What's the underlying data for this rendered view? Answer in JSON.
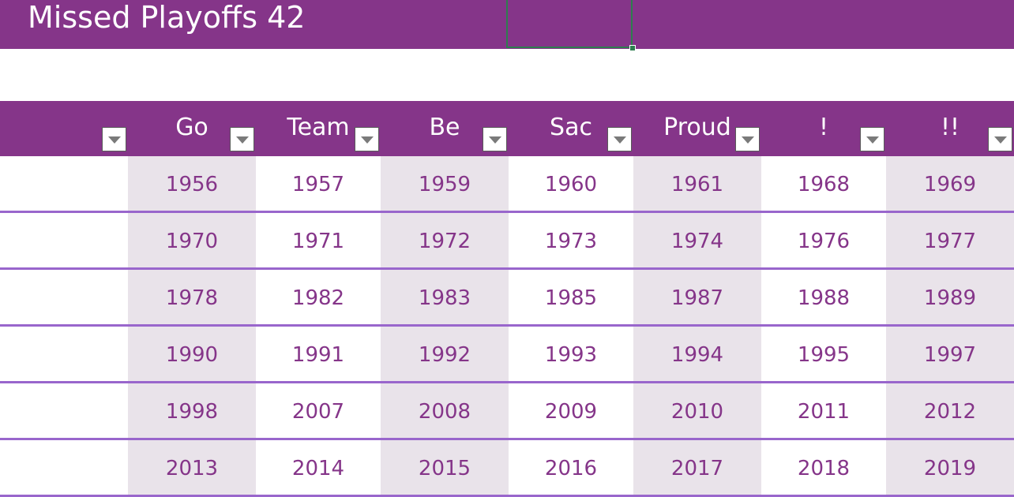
{
  "sheet": {
    "title": "Missed Playoffs 42"
  },
  "table": {
    "headers": [
      "",
      "Go",
      "Team",
      "Be",
      "Sac",
      "Proud",
      "!",
      "!!"
    ],
    "rows": [
      [
        "",
        "1956",
        "1957",
        "1959",
        "1960",
        "1961",
        "1968",
        "1969"
      ],
      [
        "",
        "1970",
        "1971",
        "1972",
        "1973",
        "1974",
        "1976",
        "1977"
      ],
      [
        "",
        "1978",
        "1982",
        "1983",
        "1985",
        "1987",
        "1988",
        "1989"
      ],
      [
        "",
        "1990",
        "1991",
        "1992",
        "1993",
        "1994",
        "1995",
        "1997"
      ],
      [
        "",
        "1998",
        "2007",
        "2008",
        "2009",
        "2010",
        "2011",
        "2012"
      ],
      [
        "",
        "2013",
        "2014",
        "2015",
        "2016",
        "2017",
        "2018",
        "2019"
      ]
    ]
  },
  "colors": {
    "header_bg": "#853589",
    "header_text": "#ffffff",
    "cell_text": "#853589",
    "band_bg": "#e9e3ea",
    "row_rule": "#9966cc",
    "selection": "#2e7d4f"
  },
  "icons": {
    "filter": "filter-dropdown-icon"
  }
}
